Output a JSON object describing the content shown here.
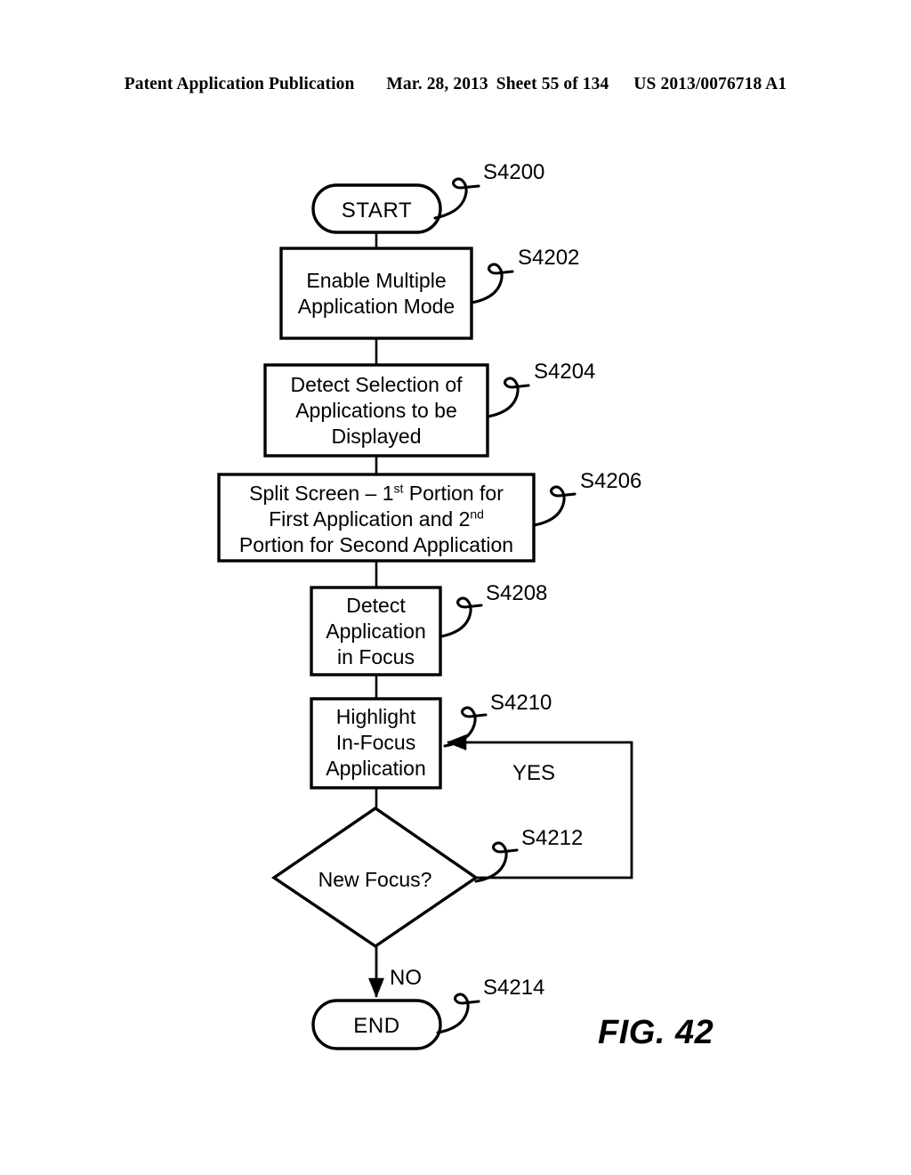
{
  "header": {
    "publication": "Patent Application Publication",
    "date": "Mar. 28, 2013",
    "sheet": "Sheet 55 of 134",
    "patent_number": "US 2013/0076718 A1"
  },
  "figure": {
    "caption": "FIG. 42",
    "line_color": "#000000",
    "fill_color": "#ffffff"
  },
  "flowchart": {
    "nodes": [
      {
        "id": "start",
        "shape": "terminal",
        "label": "START",
        "ref": "S4200"
      },
      {
        "id": "enable-multiple-application-mode",
        "shape": "process",
        "label": "Enable Multiple\nApplication Mode",
        "ref": "S4202"
      },
      {
        "id": "detect-selection-of-applications",
        "shape": "process",
        "label": "Detect Selection of\nApplications to be\nDisplayed",
        "ref": "S4204"
      },
      {
        "id": "split-screen",
        "shape": "process",
        "line1_a": "Split Screen – 1",
        "line1_sup": "st",
        "line1_b": " Portion for",
        "line2_a": "First Application and 2",
        "line2_sup": "nd",
        "line3": "Portion for Second Application",
        "label": "Split Screen – 1st Portion for First Application and 2nd Portion for Second Application",
        "ref": "S4206"
      },
      {
        "id": "detect-application-in-focus",
        "shape": "process",
        "label": "Detect\nApplication\nin Focus",
        "ref": "S4208"
      },
      {
        "id": "highlight-in-focus-application",
        "shape": "process",
        "label": "Highlight\nIn-Focus\nApplication",
        "ref": "S4210"
      },
      {
        "id": "new-focus-decision",
        "shape": "decision",
        "label": "New Focus?",
        "ref": "S4212"
      },
      {
        "id": "end",
        "shape": "terminal",
        "label": "END",
        "ref": "S4214"
      }
    ],
    "branch_labels": {
      "yes": "YES",
      "no": "NO"
    }
  }
}
